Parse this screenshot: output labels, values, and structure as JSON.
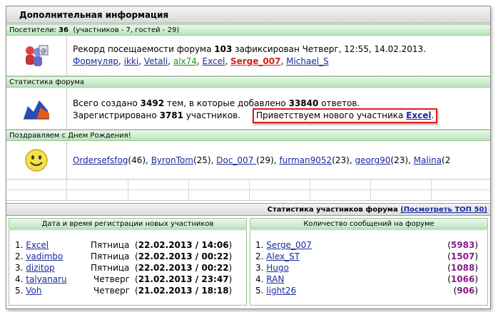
{
  "header": {
    "title": "Дополнительная информация"
  },
  "visitors": {
    "label": "Посетители:",
    "total": "36",
    "detail": "(участников - 7, гостей - 29)",
    "record_pre": "Рекорд посещаемости форума",
    "record_num": "103",
    "record_post": "зафиксирован Четверг, 12:55, 14.02.2013.",
    "users": [
      "Формуляр",
      "ikki",
      "Vetali",
      "alx74",
      "Excel",
      "Serge_007",
      "Michael_S"
    ]
  },
  "stats": {
    "title": "Статистика форума",
    "l1_a": "Всего создано",
    "topics": "3492",
    "l1_b": "тем, в которые добавлено",
    "posts": "33840",
    "l1_c": "ответов.",
    "l2_a": "Зарегистрировано",
    "members": "3781",
    "l2_b": "участников.",
    "welcome": "Приветствуем нового участника",
    "new_member": "Excel",
    "welcome_end": "."
  },
  "birthday": {
    "title": "Поздравляем с Днем Рождения!",
    "people": [
      {
        "name": "Ordersefsfog",
        "age": "(46)"
      },
      {
        "name": "ByronTom",
        "age": "(25)"
      },
      {
        "name": "Doc_007 ",
        "age": "(29)"
      },
      {
        "name": "furman9052",
        "age": "(23)"
      },
      {
        "name": "georg90",
        "age": "(23)"
      },
      {
        "name": "Malina",
        "age": "(2"
      }
    ]
  },
  "member_stats": {
    "title": "Статистика участников форума",
    "top_link": "(Посмотреть ТОП 50)",
    "left_header": "Дата и время регистрации новых участников",
    "right_header": "Количество сообщений на форуме",
    "new_members": [
      {
        "n": "1.",
        "name": "Excel",
        "day": "Пятница",
        "date": "22.02.2013 / 14:06"
      },
      {
        "n": "2.",
        "name": "vadimbo",
        "day": "Пятница",
        "date": "22.02.2013 / 00:22"
      },
      {
        "n": "3.",
        "name": "dizitop",
        "day": "Пятница",
        "date": "22.02.2013 / 00:22"
      },
      {
        "n": "4.",
        "name": "talyanaru",
        "day": "Четверг",
        "date": "21.02.2013 / 23:47"
      },
      {
        "n": "5.",
        "name": "Voh",
        "day": "Четверг",
        "date": "21.02.2013 / 18:18"
      }
    ],
    "top_posters": [
      {
        "n": "1.",
        "name": "Serge_007",
        "count": "5983"
      },
      {
        "n": "2.",
        "name": "Alex_ST",
        "count": "1507"
      },
      {
        "n": "3.",
        "name": "Hugo",
        "count": "1088"
      },
      {
        "n": "4.",
        "name": "RAN",
        "count": "1066"
      },
      {
        "n": "5.",
        "name": "light26",
        "count": "906"
      }
    ]
  },
  "colors": {
    "highlight_border": "#e01a1a",
    "link": "#1a2a9c",
    "count": "#8a1a8a",
    "special_user": "#d42020",
    "green_user": "#2a8a2a"
  }
}
